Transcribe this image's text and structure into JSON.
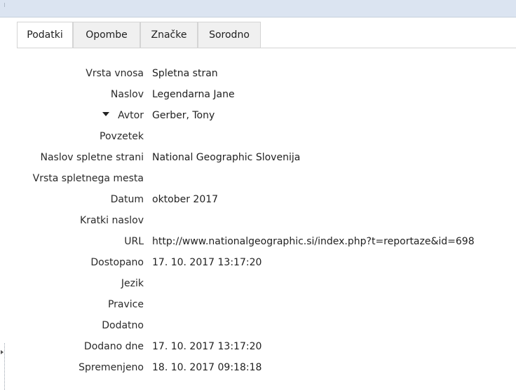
{
  "tabs": [
    {
      "label": "Podatki",
      "active": true
    },
    {
      "label": "Opombe",
      "active": false
    },
    {
      "label": "Značke",
      "active": false
    },
    {
      "label": "Sorodno",
      "active": false
    }
  ],
  "fields": [
    {
      "label": "Vrsta vnosa",
      "value": "Spletna stran"
    },
    {
      "label": "Naslov",
      "value": "Legendarna Jane"
    },
    {
      "label": "Avtor",
      "value": "Gerber, Tony",
      "expander": "triangle-down-icon"
    },
    {
      "label": "Povzetek",
      "value": ""
    },
    {
      "label": "Naslov spletne strani",
      "value": "National Geographic Slovenija"
    },
    {
      "label": "Vrsta spletnega mesta",
      "value": ""
    },
    {
      "label": "Datum",
      "value": "oktober 2017"
    },
    {
      "label": "Kratki naslov",
      "value": ""
    },
    {
      "label": "URL",
      "value": "http://www.nationalgeographic.si/index.php?t=reportaze&id=698"
    },
    {
      "label": "Dostopano",
      "value": "17. 10. 2017 13:17:20"
    },
    {
      "label": "Jezik",
      "value": ""
    },
    {
      "label": "Pravice",
      "value": ""
    },
    {
      "label": "Dodatno",
      "value": ""
    },
    {
      "label": "Dodano dne",
      "value": "17. 10. 2017 13:17:20"
    },
    {
      "label": "Spremenjeno",
      "value": "18. 10. 2017 09:18:18"
    }
  ],
  "colors": {
    "header_strip": "#dbe4f1",
    "tab_inactive": "#f0f0f0",
    "tab_border": "#d4d4d4"
  }
}
